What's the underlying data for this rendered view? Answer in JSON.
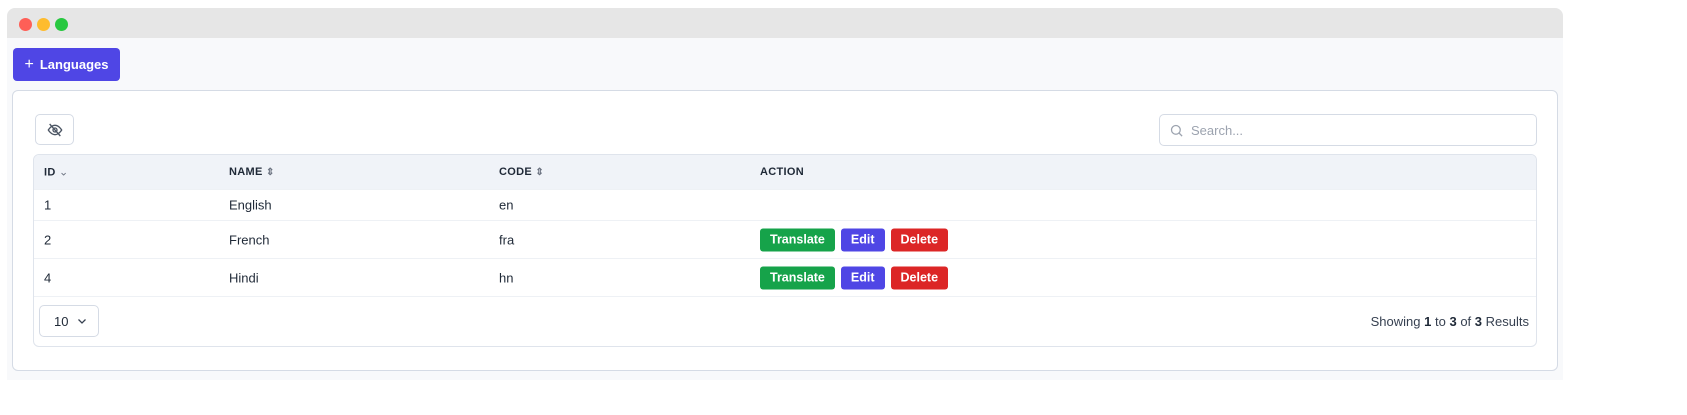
{
  "toolbar": {
    "add_label": "Languages",
    "add_icon": "plus-icon"
  },
  "search": {
    "placeholder": "Search..."
  },
  "table": {
    "headers": [
      "ID",
      "NAME",
      "CODE",
      "ACTION"
    ],
    "rows": [
      {
        "id": "1",
        "name": "English",
        "code": "en",
        "actions": false
      },
      {
        "id": "2",
        "name": "French",
        "code": "fra",
        "actions": true
      },
      {
        "id": "4",
        "name": "Hindi",
        "code": "hn",
        "actions": true
      }
    ],
    "action_labels": {
      "translate": "Translate",
      "edit": "Edit",
      "delete": "Delete"
    }
  },
  "footer": {
    "page_size": "10",
    "showing": "Showing",
    "from": "1",
    "to_word": "to",
    "to": "3",
    "of_word": "of",
    "total": "3",
    "results": "Results"
  },
  "colors": {
    "primary": "#4f46e5",
    "success": "#16a34a",
    "danger": "#dc2626"
  }
}
